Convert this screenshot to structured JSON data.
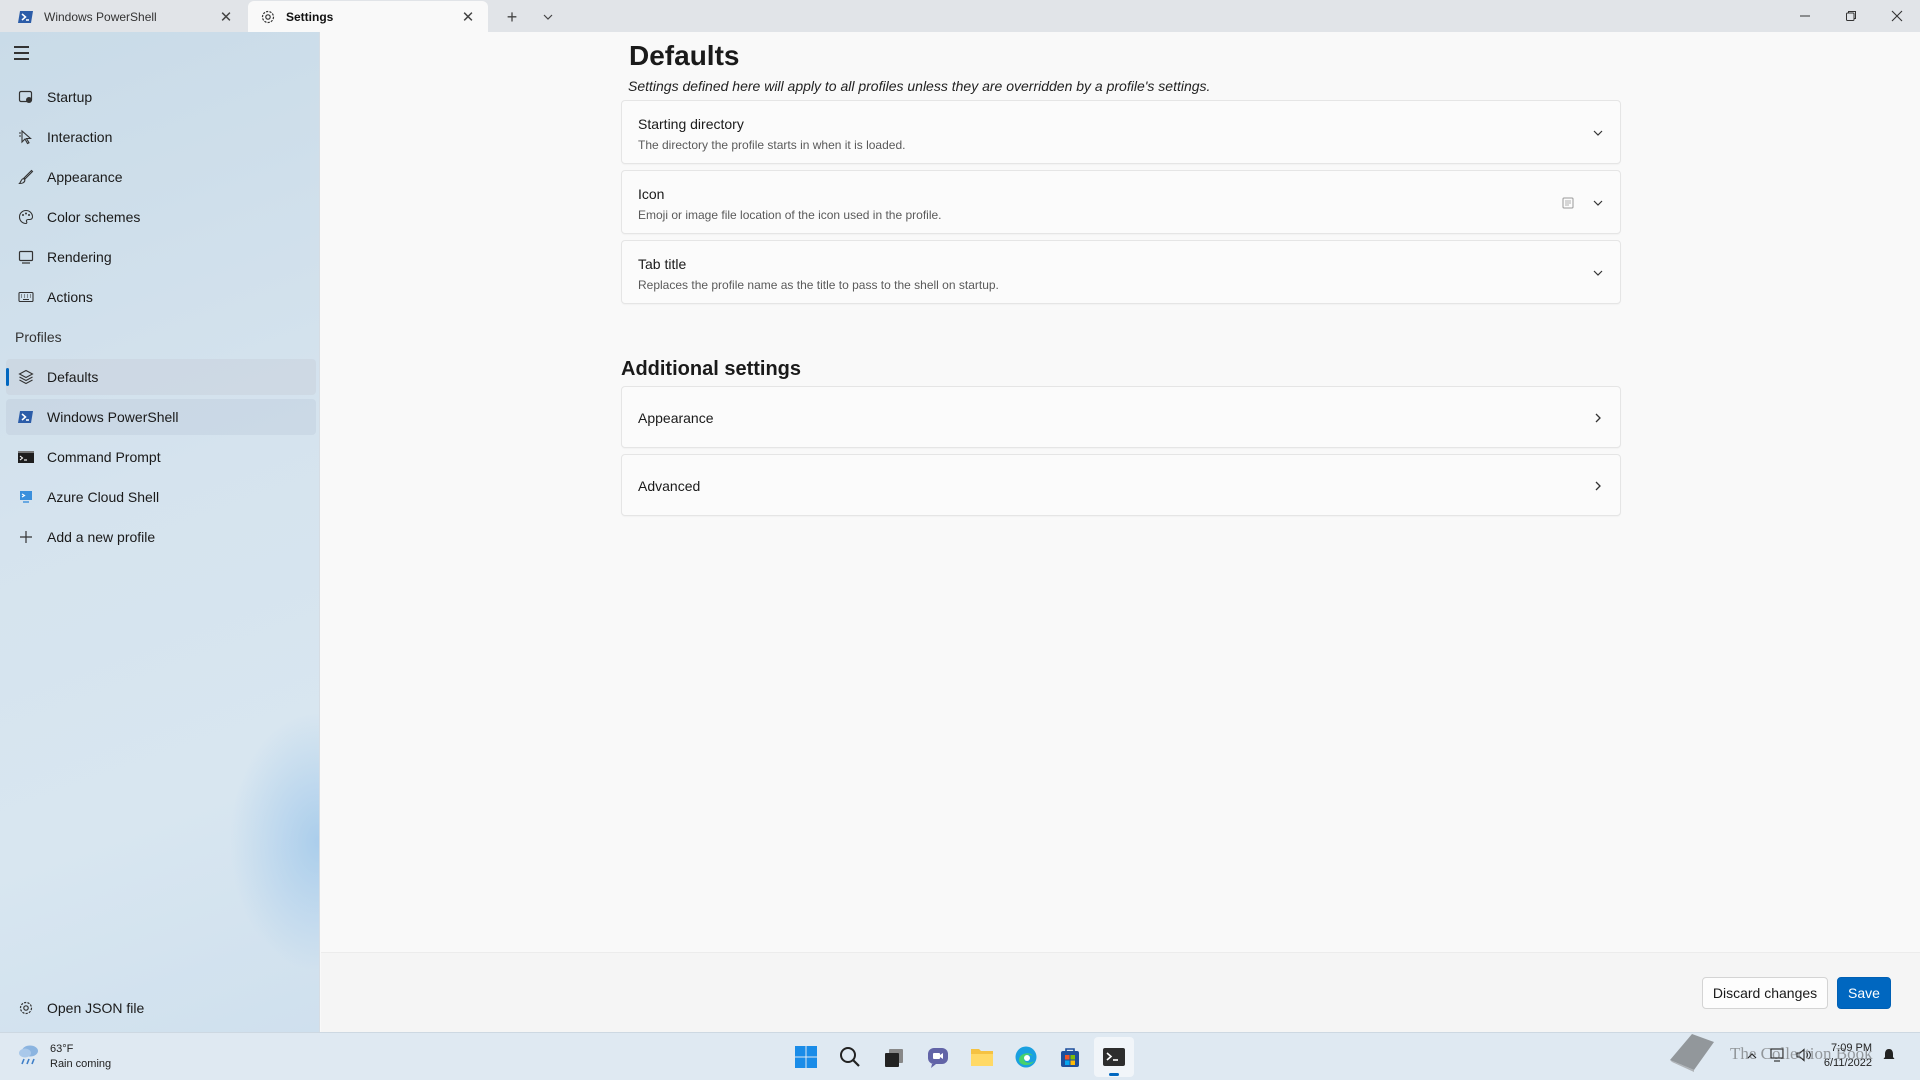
{
  "tabs": [
    {
      "label": "Windows PowerShell",
      "icon": "powershell-icon",
      "active": false
    },
    {
      "label": "Settings",
      "icon": "gear-icon",
      "active": true
    }
  ],
  "tabstrip": {
    "new_tab_icon": "plus-icon",
    "dropdown_icon": "chevron-down-icon"
  },
  "window_controls": {
    "minimize": "minimize-icon",
    "maximize": "restore-icon",
    "close": "close-icon"
  },
  "sidebar": {
    "menu_icon": "hamburger-icon",
    "items": [
      {
        "label": "Startup",
        "icon": "startup-icon"
      },
      {
        "label": "Interaction",
        "icon": "pointer-icon"
      },
      {
        "label": "Appearance",
        "icon": "brush-icon"
      },
      {
        "label": "Color schemes",
        "icon": "palette-icon"
      },
      {
        "label": "Rendering",
        "icon": "monitor-icon"
      },
      {
        "label": "Actions",
        "icon": "keyboard-icon"
      }
    ],
    "profiles_heading": "Profiles",
    "profiles": [
      {
        "label": "Defaults",
        "icon": "layers-icon",
        "selected": true
      },
      {
        "label": "Windows PowerShell",
        "icon": "powershell-icon",
        "selected": false
      },
      {
        "label": "Command Prompt",
        "icon": "cmd-icon",
        "selected": false
      },
      {
        "label": "Azure Cloud Shell",
        "icon": "azure-icon",
        "selected": false
      }
    ],
    "add_profile": "Add a new profile",
    "open_json": "Open JSON file"
  },
  "main": {
    "title": "Defaults",
    "subtitle": "Settings defined here will apply to all profiles unless they are overridden by a profile's settings.",
    "settings": [
      {
        "title": "Starting directory",
        "description": "The directory the profile starts in when it is loaded."
      },
      {
        "title": "Icon",
        "description": "Emoji or image file location of the icon used in the profile."
      },
      {
        "title": "Tab title",
        "description": "Replaces the profile name as the title to pass to the shell on startup."
      }
    ],
    "additional_heading": "Additional settings",
    "additional": [
      {
        "title": "Appearance"
      },
      {
        "title": "Advanced"
      }
    ],
    "discard_label": "Discard changes",
    "save_label": "Save"
  },
  "taskbar": {
    "weather_temp": "63°F",
    "weather_desc": "Rain coming",
    "time": "7:09 PM",
    "date": "6/11/2022",
    "watermark": "The Collection Book"
  },
  "colors": {
    "accent": "#0067c0",
    "sidebar": "#d5e3ee",
    "background": "#f9f9f9"
  }
}
